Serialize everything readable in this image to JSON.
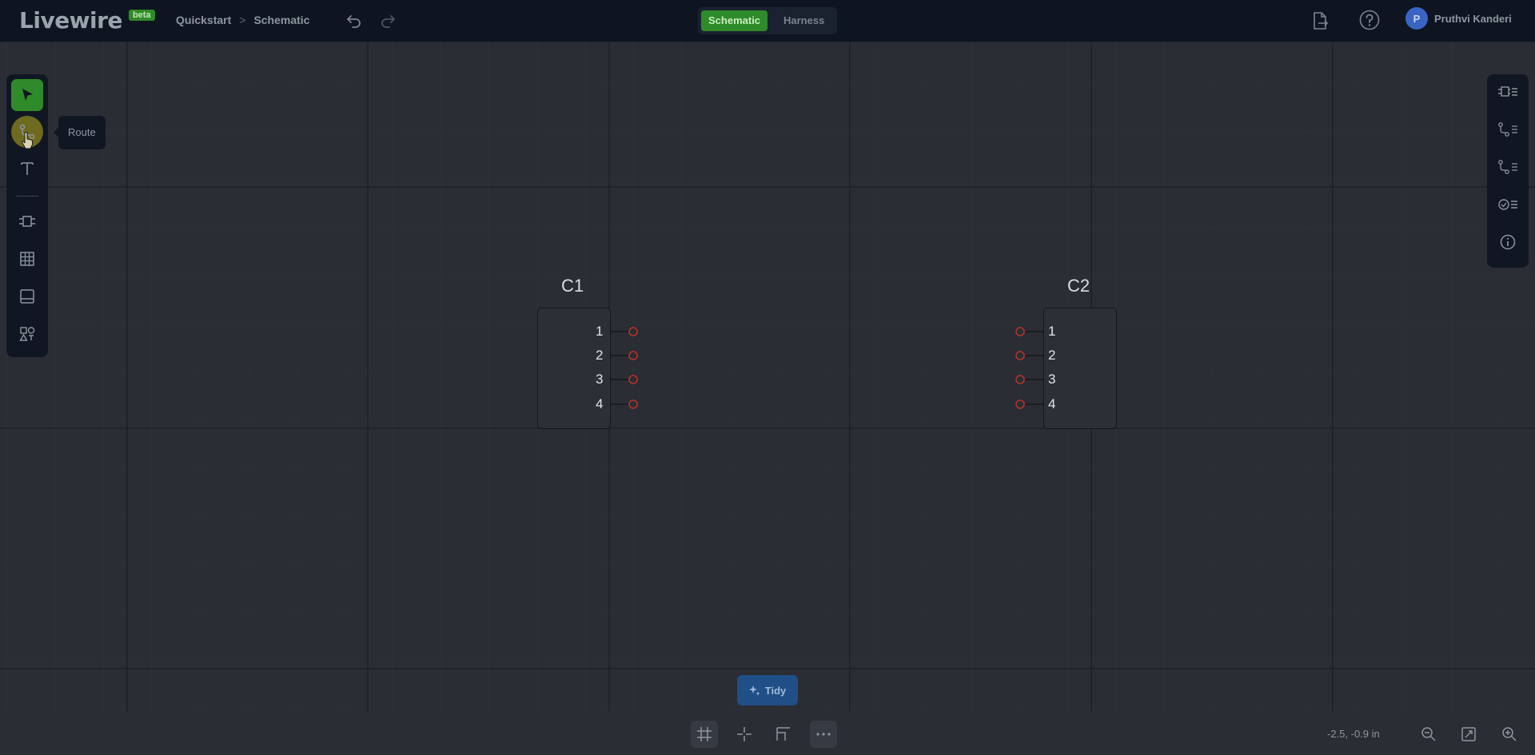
{
  "app": {
    "logo_text": "Livewire",
    "logo_badge": "beta",
    "breadcrumb": [
      "Quickstart",
      "Schematic"
    ],
    "breadcrumb_separator": ">",
    "modes": [
      "Schematic",
      "Harness"
    ],
    "active_mode": "Schematic",
    "user": {
      "initial": "P",
      "name": "Pruthvi Kanderi"
    }
  },
  "left_toolbar": {
    "tools": [
      "select-tool",
      "route-tool",
      "text-tool",
      "component-tool",
      "table-tool",
      "title-block-tool",
      "shapes-tool"
    ],
    "selected": "select-tool",
    "hovered": "route-tool",
    "tooltip": "Route"
  },
  "right_toolbar": {
    "tools": [
      "component-list-icon",
      "net-list-icon",
      "wire-list-icon",
      "checklist-icon",
      "info-icon"
    ]
  },
  "schematic": {
    "components": [
      {
        "name": "C1",
        "pins": [
          "1",
          "2",
          "3",
          "4"
        ],
        "pin_side": "right"
      },
      {
        "name": "C2",
        "pins": [
          "1",
          "2",
          "3",
          "4"
        ],
        "pin_side": "left"
      }
    ],
    "pin_color": "#b5312d"
  },
  "tidy_label": "Tidy",
  "bottom_toolbar": {
    "tools": [
      "grid-icon",
      "crosshair-icon",
      "ortho-route-icon",
      "more-icon"
    ],
    "active": [
      "grid-icon",
      "more-icon"
    ]
  },
  "status": {
    "coordinates": "-2.5, -0.9 in"
  },
  "colors": {
    "accent_green": "#2f8a2a",
    "tidy_blue": "#1f4f86",
    "topbar_bg": "#0f1520"
  }
}
